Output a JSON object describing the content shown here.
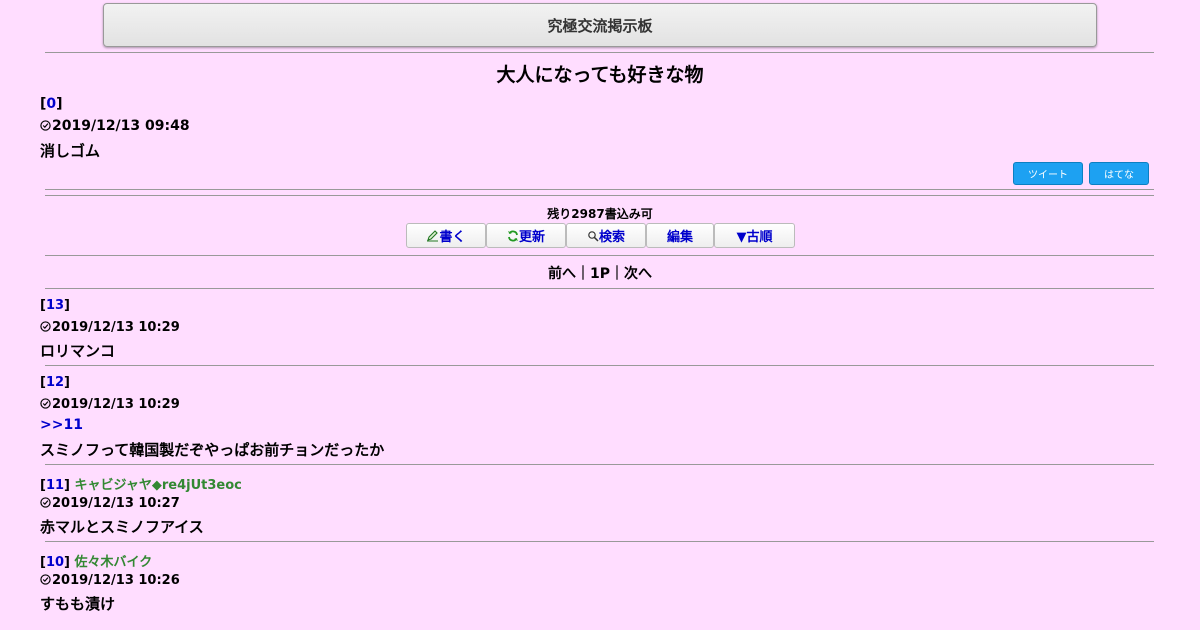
{
  "header": {
    "board_title": "究極交流掲示板"
  },
  "thread": {
    "title": "大人になっても好きな物",
    "op": {
      "number": "0",
      "timestamp": "2019/12/13 09:48",
      "body": "消しゴム"
    }
  },
  "share": {
    "tweet_label": "ツイート",
    "hatena_label": "はてな"
  },
  "status": {
    "remaining": "残り2987書込み可"
  },
  "toolbar": {
    "write_label": "書く",
    "refresh_label": "更新",
    "search_label": "検索",
    "edit_label": "編集",
    "order_label": "▼古順"
  },
  "pager": {
    "prev": "前へ",
    "page": "1P",
    "next": "次へ",
    "separator": "｜"
  },
  "posts": [
    {
      "number": "13",
      "name": "",
      "timestamp": "2019/12/13 10:29",
      "anchor": "",
      "body": "ロリマンコ"
    },
    {
      "number": "12",
      "name": "",
      "timestamp": "2019/12/13 10:29",
      "anchor": ">>11",
      "body": "スミノフって韓国製だぞやっぱお前チョンだったか"
    },
    {
      "number": "11",
      "name": "キャビジャヤ◆re4jUt3eoc",
      "timestamp": "2019/12/13 10:27",
      "anchor": "",
      "body": "赤マルとスミノフアイス"
    },
    {
      "number": "10",
      "name": "佐々木バイク",
      "timestamp": "2019/12/13 10:26",
      "anchor": "",
      "body": "すもも漬け"
    }
  ],
  "colors": {
    "background": "#ffddff",
    "link": "#0000cc",
    "name": "#338833",
    "tweet": "#1da1f2"
  }
}
